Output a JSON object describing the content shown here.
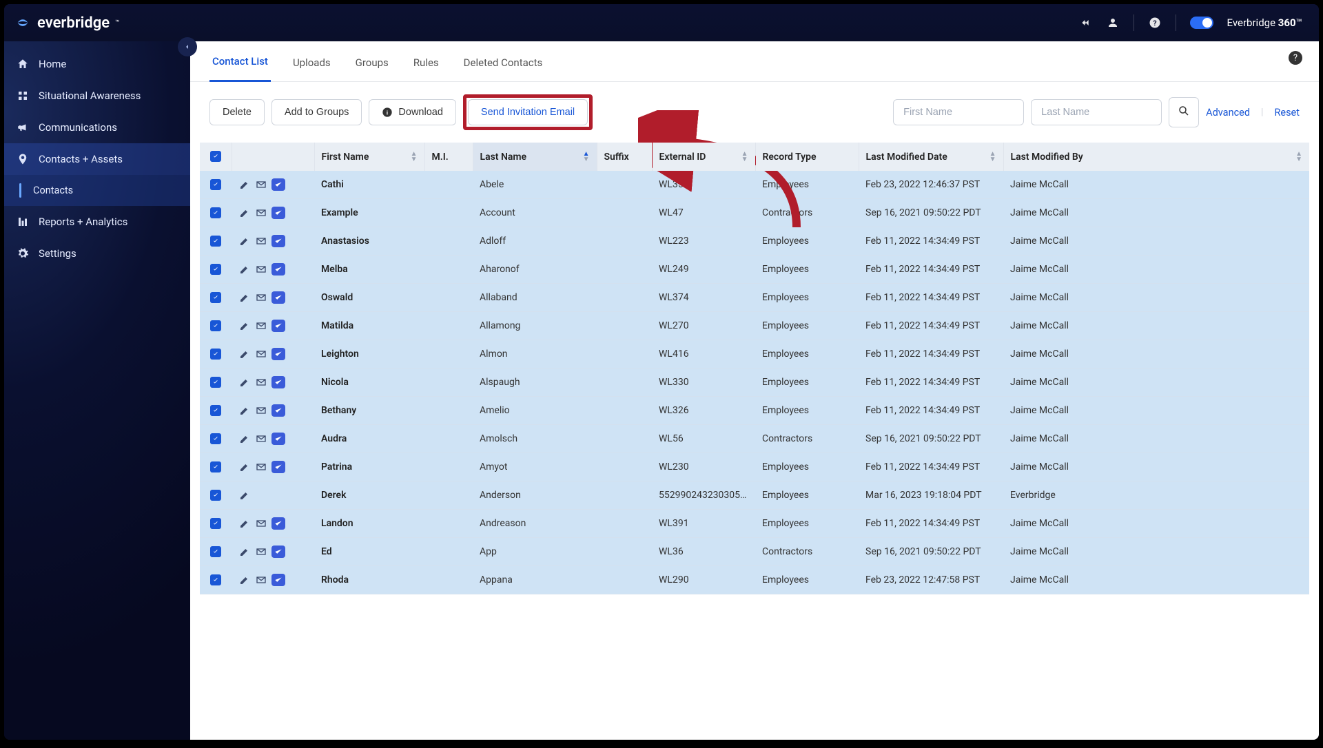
{
  "brand": {
    "name": "everbridge",
    "suite_prefix": "Everbridge",
    "suite_bold": "360",
    "tm": "™"
  },
  "sidebar": {
    "items": [
      {
        "id": "home",
        "label": "Home"
      },
      {
        "id": "situational",
        "label": "Situational Awareness"
      },
      {
        "id": "communications",
        "label": "Communications"
      },
      {
        "id": "contacts-assets",
        "label": "Contacts + Assets"
      },
      {
        "id": "contacts",
        "label": "Contacts"
      },
      {
        "id": "reports",
        "label": "Reports + Analytics"
      },
      {
        "id": "settings",
        "label": "Settings"
      }
    ]
  },
  "tabs": [
    {
      "id": "contact-list",
      "label": "Contact List",
      "active": true
    },
    {
      "id": "uploads",
      "label": "Uploads"
    },
    {
      "id": "groups",
      "label": "Groups"
    },
    {
      "id": "rules",
      "label": "Rules"
    },
    {
      "id": "deleted",
      "label": "Deleted Contacts"
    }
  ],
  "toolbar": {
    "delete": "Delete",
    "add_to_groups": "Add to Groups",
    "download": "Download",
    "send_invitation": "Send Invitation Email",
    "first_placeholder": "First Name",
    "last_placeholder": "Last Name",
    "advanced": "Advanced",
    "reset": "Reset"
  },
  "columns": {
    "first": "First Name",
    "mi": "M.I.",
    "last": "Last Name",
    "suffix": "Suffix",
    "external": "External ID",
    "record": "Record Type",
    "modified_date": "Last Modified Date",
    "modified_by": "Last Modified By"
  },
  "rows": [
    {
      "first": "Cathi",
      "last": "Abele",
      "ext": "WL356",
      "rec": "Employees",
      "date": "Feb 23, 2022 12:46:37 PST",
      "by": "Jaime McCall",
      "icons": 3
    },
    {
      "first": "Example",
      "last": "Account",
      "ext": "WL47",
      "rec": "Contractors",
      "date": "Sep 16, 2021 09:50:22 PDT",
      "by": "Jaime McCall",
      "icons": 3
    },
    {
      "first": "Anastasios",
      "last": "Adloff",
      "ext": "WL223",
      "rec": "Employees",
      "date": "Feb 11, 2022 14:34:49 PST",
      "by": "Jaime McCall",
      "icons": 3
    },
    {
      "first": "Melba",
      "last": "Aharonof",
      "ext": "WL249",
      "rec": "Employees",
      "date": "Feb 11, 2022 14:34:49 PST",
      "by": "Jaime McCall",
      "icons": 3
    },
    {
      "first": "Oswald",
      "last": "Allaband",
      "ext": "WL374",
      "rec": "Employees",
      "date": "Feb 11, 2022 14:34:49 PST",
      "by": "Jaime McCall",
      "icons": 3
    },
    {
      "first": "Matilda",
      "last": "Allamong",
      "ext": "WL270",
      "rec": "Employees",
      "date": "Feb 11, 2022 14:34:49 PST",
      "by": "Jaime McCall",
      "icons": 3
    },
    {
      "first": "Leighton",
      "last": "Almon",
      "ext": "WL416",
      "rec": "Employees",
      "date": "Feb 11, 2022 14:34:49 PST",
      "by": "Jaime McCall",
      "icons": 3
    },
    {
      "first": "Nicola",
      "last": "Alspaugh",
      "ext": "WL330",
      "rec": "Employees",
      "date": "Feb 11, 2022 14:34:49 PST",
      "by": "Jaime McCall",
      "icons": 3
    },
    {
      "first": "Bethany",
      "last": "Amelio",
      "ext": "WL326",
      "rec": "Employees",
      "date": "Feb 11, 2022 14:34:49 PST",
      "by": "Jaime McCall",
      "icons": 3
    },
    {
      "first": "Audra",
      "last": "Amolsch",
      "ext": "WL56",
      "rec": "Contractors",
      "date": "Sep 16, 2021 09:50:22 PDT",
      "by": "Jaime McCall",
      "icons": 3
    },
    {
      "first": "Patrina",
      "last": "Amyot",
      "ext": "WL230",
      "rec": "Employees",
      "date": "Feb 11, 2022 14:34:49 PST",
      "by": "Jaime McCall",
      "icons": 3
    },
    {
      "first": "Derek",
      "last": "Anderson",
      "ext": "552990243230305…",
      "rec": "Employees",
      "date": "Mar 16, 2023 19:18:04 PDT",
      "by": "Everbridge",
      "icons": 1
    },
    {
      "first": "Landon",
      "last": "Andreason",
      "ext": "WL391",
      "rec": "Employees",
      "date": "Feb 11, 2022 14:34:49 PST",
      "by": "Jaime McCall",
      "icons": 3
    },
    {
      "first": "Ed",
      "last": "App",
      "ext": "WL36",
      "rec": "Contractors",
      "date": "Sep 16, 2021 09:50:22 PDT",
      "by": "Jaime McCall",
      "icons": 3
    },
    {
      "first": "Rhoda",
      "last": "Appana",
      "ext": "WL290",
      "rec": "Employees",
      "date": "Feb 23, 2022 12:47:58 PST",
      "by": "Jaime McCall",
      "icons": 3
    }
  ]
}
